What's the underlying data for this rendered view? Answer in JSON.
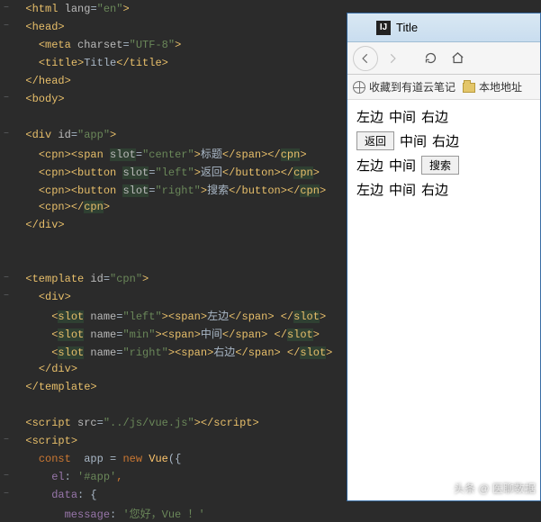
{
  "editor": {
    "lines": [
      {
        "ind": 1,
        "col": true,
        "seg": [
          {
            "c": "ang",
            "t": "<"
          },
          {
            "c": "tag",
            "t": "html "
          },
          {
            "c": "attr",
            "t": "lang"
          },
          {
            "c": "plain",
            "t": "="
          },
          {
            "c": "str",
            "t": "\"en\""
          },
          {
            "c": "ang",
            "t": ">"
          }
        ]
      },
      {
        "ind": 1,
        "col": true,
        "seg": [
          {
            "c": "ang",
            "t": "<"
          },
          {
            "c": "tag",
            "t": "head"
          },
          {
            "c": "ang",
            "t": ">"
          }
        ]
      },
      {
        "ind": 2,
        "seg": [
          {
            "c": "ang",
            "t": "<"
          },
          {
            "c": "tag",
            "t": "meta "
          },
          {
            "c": "attr",
            "t": "charset"
          },
          {
            "c": "plain",
            "t": "="
          },
          {
            "c": "str",
            "t": "\"UTF-8\""
          },
          {
            "c": "ang",
            "t": ">"
          }
        ]
      },
      {
        "ind": 2,
        "seg": [
          {
            "c": "ang",
            "t": "<"
          },
          {
            "c": "tag",
            "t": "title"
          },
          {
            "c": "ang",
            "t": ">"
          },
          {
            "c": "plain",
            "t": "Title"
          },
          {
            "c": "ang",
            "t": "</"
          },
          {
            "c": "tag",
            "t": "title"
          },
          {
            "c": "ang",
            "t": ">"
          }
        ]
      },
      {
        "ind": 1,
        "seg": [
          {
            "c": "ang",
            "t": "</"
          },
          {
            "c": "tag",
            "t": "head"
          },
          {
            "c": "ang",
            "t": ">"
          }
        ]
      },
      {
        "ind": 1,
        "col": true,
        "seg": [
          {
            "c": "ang",
            "t": "<"
          },
          {
            "c": "tag",
            "t": "body"
          },
          {
            "c": "ang",
            "t": ">"
          }
        ]
      },
      {
        "ind": 1,
        "blank": true
      },
      {
        "ind": 1,
        "col": true,
        "seg": [
          {
            "c": "ang",
            "t": "<"
          },
          {
            "c": "tag",
            "t": "div "
          },
          {
            "c": "attr",
            "t": "id"
          },
          {
            "c": "plain",
            "t": "="
          },
          {
            "c": "str",
            "t": "\"app\""
          },
          {
            "c": "ang",
            "t": ">"
          }
        ]
      },
      {
        "ind": 2,
        "seg": [
          {
            "c": "ang",
            "t": "<"
          },
          {
            "c": "tag",
            "t": "cpn"
          },
          {
            "c": "ang",
            "t": "><"
          },
          {
            "c": "tag",
            "t": "span "
          },
          {
            "c": "attr hl",
            "t": "slot"
          },
          {
            "c": "plain",
            "t": "="
          },
          {
            "c": "str",
            "t": "\"center\""
          },
          {
            "c": "ang",
            "t": ">"
          },
          {
            "c": "plain",
            "t": "标题"
          },
          {
            "c": "ang",
            "t": "</"
          },
          {
            "c": "tag",
            "t": "span"
          },
          {
            "c": "ang",
            "t": "></"
          },
          {
            "c": "tag hl",
            "t": "cpn"
          },
          {
            "c": "ang",
            "t": ">"
          }
        ]
      },
      {
        "ind": 2,
        "seg": [
          {
            "c": "ang",
            "t": "<"
          },
          {
            "c": "tag",
            "t": "cpn"
          },
          {
            "c": "ang",
            "t": "><"
          },
          {
            "c": "tag",
            "t": "button "
          },
          {
            "c": "attr hl",
            "t": "slot"
          },
          {
            "c": "plain",
            "t": "="
          },
          {
            "c": "str",
            "t": "\"left\""
          },
          {
            "c": "ang",
            "t": ">"
          },
          {
            "c": "plain",
            "t": "返回"
          },
          {
            "c": "ang",
            "t": "</"
          },
          {
            "c": "tag",
            "t": "button"
          },
          {
            "c": "ang",
            "t": "></"
          },
          {
            "c": "tag hl",
            "t": "cpn"
          },
          {
            "c": "ang",
            "t": ">"
          }
        ]
      },
      {
        "ind": 2,
        "seg": [
          {
            "c": "ang",
            "t": "<"
          },
          {
            "c": "tag",
            "t": "cpn"
          },
          {
            "c": "ang",
            "t": "><"
          },
          {
            "c": "tag",
            "t": "button "
          },
          {
            "c": "attr hl",
            "t": "slot"
          },
          {
            "c": "plain",
            "t": "="
          },
          {
            "c": "str",
            "t": "\"right\""
          },
          {
            "c": "ang",
            "t": ">"
          },
          {
            "c": "plain",
            "t": "搜索"
          },
          {
            "c": "ang",
            "t": "</"
          },
          {
            "c": "tag",
            "t": "button"
          },
          {
            "c": "ang",
            "t": "></"
          },
          {
            "c": "tag hl",
            "t": "cpn"
          },
          {
            "c": "ang",
            "t": ">"
          }
        ]
      },
      {
        "ind": 2,
        "seg": [
          {
            "c": "ang",
            "t": "<"
          },
          {
            "c": "tag",
            "t": "cpn"
          },
          {
            "c": "ang",
            "t": "></"
          },
          {
            "c": "tag hl",
            "t": "cpn"
          },
          {
            "c": "ang",
            "t": ">"
          }
        ]
      },
      {
        "ind": 1,
        "seg": [
          {
            "c": "ang",
            "t": "</"
          },
          {
            "c": "tag",
            "t": "div"
          },
          {
            "c": "ang",
            "t": ">"
          }
        ]
      },
      {
        "ind": 1,
        "blank": true
      },
      {
        "ind": 1,
        "blank": true
      },
      {
        "ind": 1,
        "col": true,
        "seg": [
          {
            "c": "ang",
            "t": "<"
          },
          {
            "c": "tag",
            "t": "template "
          },
          {
            "c": "attr",
            "t": "id"
          },
          {
            "c": "plain",
            "t": "="
          },
          {
            "c": "str",
            "t": "\"cpn\""
          },
          {
            "c": "ang",
            "t": ">"
          }
        ]
      },
      {
        "ind": 2,
        "col": true,
        "seg": [
          {
            "c": "ang",
            "t": "<"
          },
          {
            "c": "tag",
            "t": "div"
          },
          {
            "c": "ang",
            "t": ">"
          }
        ]
      },
      {
        "ind": 3,
        "seg": [
          {
            "c": "ang",
            "t": "<"
          },
          {
            "c": "tag hl",
            "t": "slot"
          },
          {
            "c": "attr",
            "t": " name"
          },
          {
            "c": "plain",
            "t": "="
          },
          {
            "c": "str",
            "t": "\"left\""
          },
          {
            "c": "ang",
            "t": "><"
          },
          {
            "c": "tag",
            "t": "span"
          },
          {
            "c": "ang",
            "t": ">"
          },
          {
            "c": "plain",
            "t": "左边"
          },
          {
            "c": "ang",
            "t": "</"
          },
          {
            "c": "tag",
            "t": "span"
          },
          {
            "c": "ang",
            "t": "> </"
          },
          {
            "c": "tag hl",
            "t": "slot"
          },
          {
            "c": "ang",
            "t": ">"
          }
        ]
      },
      {
        "ind": 3,
        "seg": [
          {
            "c": "ang",
            "t": "<"
          },
          {
            "c": "tag hl",
            "t": "slot"
          },
          {
            "c": "attr",
            "t": " name"
          },
          {
            "c": "plain",
            "t": "="
          },
          {
            "c": "str",
            "t": "\"min\""
          },
          {
            "c": "ang",
            "t": "><"
          },
          {
            "c": "tag",
            "t": "span"
          },
          {
            "c": "ang",
            "t": ">"
          },
          {
            "c": "plain",
            "t": "中间"
          },
          {
            "c": "ang",
            "t": "</"
          },
          {
            "c": "tag",
            "t": "span"
          },
          {
            "c": "ang",
            "t": "> </"
          },
          {
            "c": "tag hl",
            "t": "slot"
          },
          {
            "c": "ang",
            "t": ">"
          }
        ]
      },
      {
        "ind": 3,
        "seg": [
          {
            "c": "ang",
            "t": "<"
          },
          {
            "c": "tag hl",
            "t": "slot"
          },
          {
            "c": "attr",
            "t": " name"
          },
          {
            "c": "plain",
            "t": "="
          },
          {
            "c": "str",
            "t": "\"right\""
          },
          {
            "c": "ang",
            "t": "><"
          },
          {
            "c": "tag",
            "t": "span"
          },
          {
            "c": "ang",
            "t": ">"
          },
          {
            "c": "plain",
            "t": "右边"
          },
          {
            "c": "ang",
            "t": "</"
          },
          {
            "c": "tag",
            "t": "span"
          },
          {
            "c": "ang",
            "t": "> </"
          },
          {
            "c": "tag hl",
            "t": "slot"
          },
          {
            "c": "ang",
            "t": ">"
          }
        ]
      },
      {
        "ind": 2,
        "seg": [
          {
            "c": "ang",
            "t": "</"
          },
          {
            "c": "tag",
            "t": "div"
          },
          {
            "c": "ang",
            "t": ">"
          }
        ]
      },
      {
        "ind": 1,
        "seg": [
          {
            "c": "ang",
            "t": "</"
          },
          {
            "c": "tag",
            "t": "template"
          },
          {
            "c": "ang",
            "t": ">"
          }
        ]
      },
      {
        "ind": 1,
        "blank": true
      },
      {
        "ind": 1,
        "seg": [
          {
            "c": "ang",
            "t": "<"
          },
          {
            "c": "tag",
            "t": "script "
          },
          {
            "c": "attr",
            "t": "src"
          },
          {
            "c": "plain",
            "t": "="
          },
          {
            "c": "str",
            "t": "\"../js/vue.js\""
          },
          {
            "c": "ang",
            "t": "></"
          },
          {
            "c": "tag",
            "t": "script"
          },
          {
            "c": "ang",
            "t": ">"
          }
        ]
      },
      {
        "ind": 1,
        "col": true,
        "seg": [
          {
            "c": "ang",
            "t": "<"
          },
          {
            "c": "tag",
            "t": "script"
          },
          {
            "c": "ang",
            "t": ">"
          }
        ]
      },
      {
        "ind": 2,
        "seg": [
          {
            "c": "kw",
            "t": "const "
          },
          {
            "c": "cls",
            "t": " app"
          },
          {
            "c": "plain",
            "t": " = "
          },
          {
            "c": "kw",
            "t": "new "
          },
          {
            "c": "vue",
            "t": "Vue"
          },
          {
            "c": "plain",
            "t": "({"
          }
        ]
      },
      {
        "ind": 3,
        "col": true,
        "seg": [
          {
            "c": "prop",
            "t": "el"
          },
          {
            "c": "plain",
            "t": ": "
          },
          {
            "c": "str",
            "t": "'#app'"
          },
          {
            "c": "kw",
            "t": ","
          }
        ]
      },
      {
        "ind": 3,
        "col": true,
        "seg": [
          {
            "c": "prop",
            "t": "data"
          },
          {
            "c": "plain",
            "t": ": {"
          }
        ]
      },
      {
        "ind": 4,
        "seg": [
          {
            "c": "prop",
            "t": "message"
          },
          {
            "c": "plain",
            "t": ": "
          },
          {
            "c": "str",
            "t": "'您好，Vue ！'"
          }
        ]
      }
    ]
  },
  "browser": {
    "title": "Title",
    "bookmarks": {
      "b1": "收藏到有道云笔记",
      "b2": "本地地址"
    },
    "page": {
      "r1": {
        "a": "左边",
        "b": "中间",
        "c": "右边"
      },
      "r2": {
        "btn": "返回",
        "b": "中间",
        "c": "右边"
      },
      "r3": {
        "a": "左边",
        "b": "中间",
        "btn": "搜索"
      },
      "r4": {
        "a": "左边",
        "b": "中间",
        "c": "右边"
      }
    }
  },
  "watermark": "头条 @ 医聊数据"
}
